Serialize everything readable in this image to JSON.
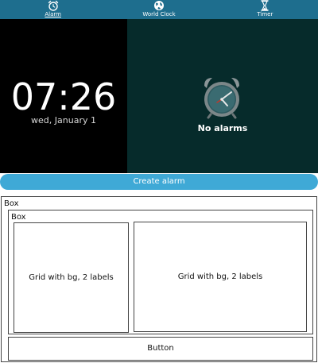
{
  "tabs": [
    {
      "label": "Alarm",
      "icon": "alarm-clock-icon",
      "active": true
    },
    {
      "label": "World Clock",
      "icon": "globe-icon",
      "active": false
    },
    {
      "label": "Timer",
      "icon": "hourglass-icon",
      "active": false
    }
  ],
  "clock": {
    "time": "07:26",
    "date": "wed, January 1"
  },
  "alarms": {
    "empty_label": "No alarms",
    "icon": "alarm-clock-icon"
  },
  "create_alarm": {
    "label": "Create alarm"
  },
  "outer_box": {
    "label": "Box",
    "inner_box": {
      "label": "Box",
      "grids": [
        {
          "label": "Grid with bg, 2 labels"
        },
        {
          "label": "Grid with bg, 2 labels"
        }
      ]
    },
    "button": {
      "label": "Button"
    }
  },
  "colors": {
    "tabbar_bg": "#1e6e8e",
    "clock_bg": "#000000",
    "alarm_panel_bg": "#062b2b",
    "create_bar_bg": "#3fa9d6"
  }
}
